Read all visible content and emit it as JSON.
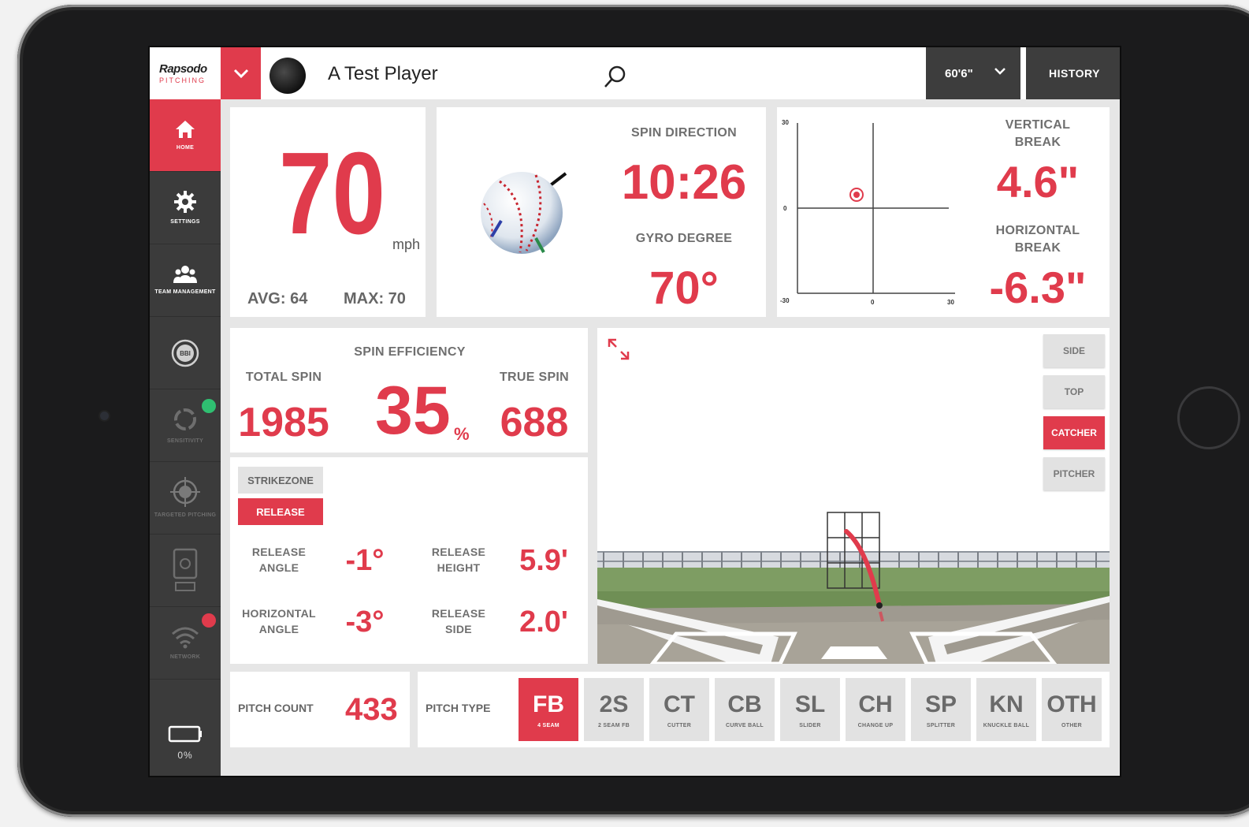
{
  "header": {
    "logo_text": "Rapsodo",
    "logo_sub": "PITCHING",
    "player_name": "A Test Player",
    "distance": "60'6\"",
    "history_label": "HISTORY"
  },
  "sidebar": {
    "items": [
      {
        "label": "HOME",
        "icon": "home-icon"
      },
      {
        "label": "SETTINGS",
        "icon": "gear-icon"
      },
      {
        "label": "TEAM MANAGEMENT",
        "icon": "team-icon"
      },
      {
        "label": "",
        "icon": "bbi-icon"
      },
      {
        "label": "SENSITIVITY",
        "icon": "sensitivity-icon"
      },
      {
        "label": "TARGETED PITCHING",
        "icon": "target-icon"
      },
      {
        "label": "",
        "icon": "device-icon"
      },
      {
        "label": "NETWORK",
        "icon": "wifi-icon"
      }
    ],
    "battery": "0%",
    "status_colors": {
      "ok": "#2fbf71",
      "error": "#e03b4c"
    }
  },
  "velocity": {
    "value": "70",
    "unit": "mph",
    "avg": "AVG: 64",
    "max": "MAX: 70"
  },
  "spin_direction": {
    "title": "SPIN DIRECTION",
    "value": "10:26",
    "gyro_title": "GYRO DEGREE",
    "gyro_value": "70°"
  },
  "break": {
    "vertical_title_1": "VERTICAL",
    "vertical_title_2": "BREAK",
    "vertical_value": "4.6\"",
    "horizontal_title_1": "HORIZONTAL",
    "horizontal_title_2": "BREAK",
    "horizontal_value": "-6.3\"",
    "axis_labels": {
      "top": "30",
      "middle": "0",
      "bottom": "-30",
      "left": "-30",
      "center": "0",
      "right": "30"
    }
  },
  "spin_eff": {
    "title": "SPIN EFFICIENCY",
    "total_title": "TOTAL SPIN",
    "total_value": "1985",
    "eff_value": "35",
    "eff_unit": "%",
    "true_title": "TRUE SPIN",
    "true_value": "688"
  },
  "release": {
    "tab_strikezone": "STRIKEZONE",
    "tab_release": "RELEASE",
    "angle_title_1": "RELEASE",
    "angle_title_2": "ANGLE",
    "angle_value": "-1°",
    "height_title_1": "RELEASE",
    "height_title_2": "HEIGHT",
    "height_value": "5.9'",
    "hangle_title_1": "HORIZONTAL",
    "hangle_title_2": "ANGLE",
    "hangle_value": "-3°",
    "side_title_1": "RELEASE",
    "side_title_2": "SIDE",
    "side_value": "2.0'"
  },
  "view": {
    "buttons": [
      "SIDE",
      "TOP",
      "CATCHER",
      "PITCHER"
    ],
    "active": "CATCHER"
  },
  "footer": {
    "pitch_count_label": "PITCH COUNT",
    "pitch_count_value": "433",
    "pitch_type_label": "PITCH TYPE",
    "pitch_types": [
      {
        "code": "FB",
        "sub": "4 SEAM"
      },
      {
        "code": "2S",
        "sub": "2 SEAM FB"
      },
      {
        "code": "CT",
        "sub": "CUTTER"
      },
      {
        "code": "CB",
        "sub": "CURVE BALL"
      },
      {
        "code": "SL",
        "sub": "SLIDER"
      },
      {
        "code": "CH",
        "sub": "CHANGE UP"
      },
      {
        "code": "SP",
        "sub": "SPLITTER"
      },
      {
        "code": "KN",
        "sub": "KNUCKLE BALL"
      },
      {
        "code": "OTH",
        "sub": "OTHER"
      }
    ],
    "active_pitch": "FB"
  },
  "colors": {
    "accent": "#e03b4c",
    "dark": "#3d3d3d",
    "panel": "#ffffff",
    "bg": "#e6e6e6"
  }
}
